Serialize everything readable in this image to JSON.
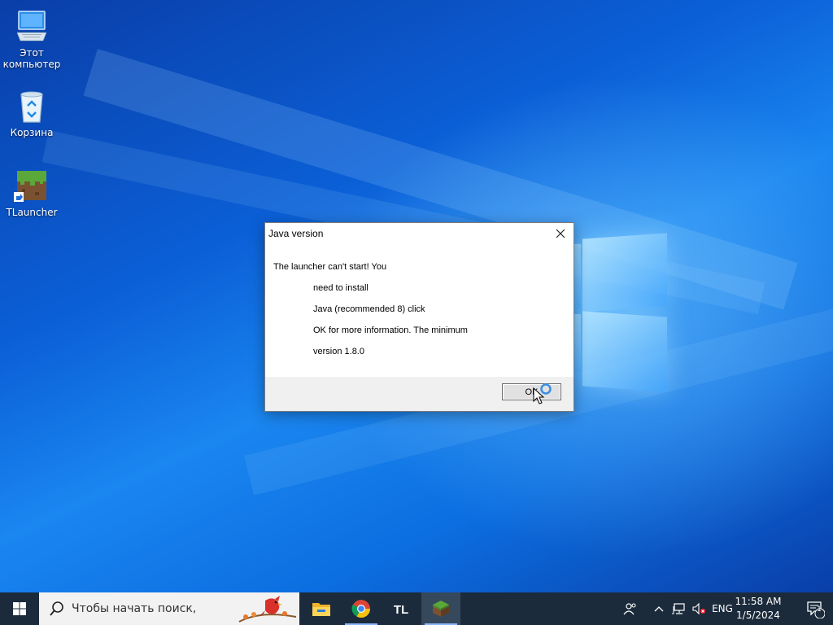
{
  "desktop": {
    "icons": [
      {
        "label": "Этот компьютер",
        "icon": "this-pc-icon"
      },
      {
        "label": "Корзина",
        "icon": "recycle-bin-icon"
      },
      {
        "label": "TLauncher",
        "icon": "minecraft-grass-block-icon"
      }
    ]
  },
  "dialog": {
    "title": "Java version",
    "close_icon": "close-icon",
    "message_lines": [
      "The launcher can't start! You",
      "need to install",
      "Java (recommended 8) click",
      "OK for more information. The minimum",
      "version 1.8.0"
    ],
    "ok_label": "OK"
  },
  "taskbar": {
    "start_icon": "windows-start-icon",
    "search_placeholder": "Чтобы начать поиск,",
    "apps": [
      {
        "name": "File Explorer",
        "icon": "file-explorer-icon"
      },
      {
        "name": "Google Chrome",
        "icon": "chrome-icon"
      },
      {
        "name": "TL",
        "icon": "tlauncher-icon"
      },
      {
        "name": "Minecraft",
        "icon": "minecraft-icon",
        "active": true
      }
    ],
    "tray": {
      "language": "ENG",
      "time": "11:58 AM",
      "date": "1/5/2024",
      "notification_count": "1"
    }
  },
  "colors": {
    "taskbar": "#1b2b3c",
    "accent": "#0078d7"
  }
}
